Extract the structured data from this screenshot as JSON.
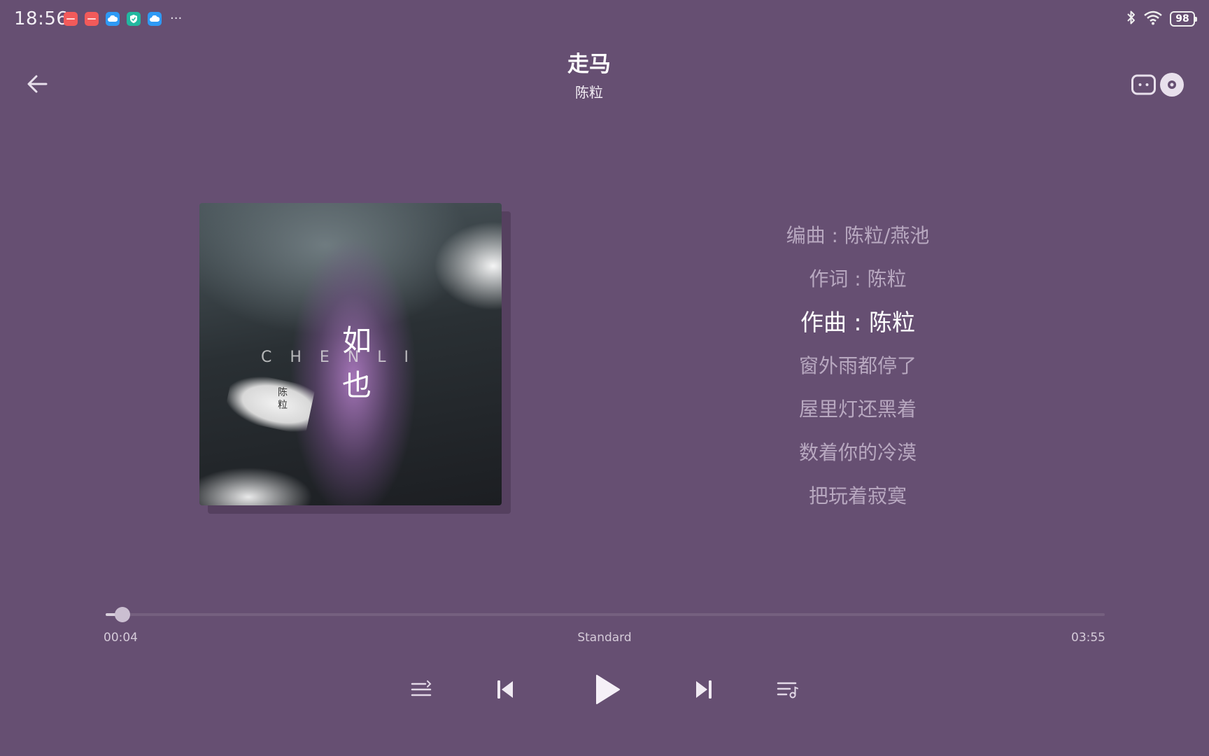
{
  "status_bar": {
    "time": "18:56",
    "notification_icons": [
      "app-notification-icon",
      "app-notification-icon",
      "cloud-icon",
      "shield-icon",
      "cloud-icon"
    ],
    "more": "···",
    "battery": "98"
  },
  "header": {
    "title": "走马",
    "artist": "陈粒"
  },
  "album": {
    "cover_letters": "CHENLI",
    "cover_glyph_top": "如",
    "cover_glyph_bottom": "也",
    "cover_seal": "陈粒"
  },
  "lyrics": [
    {
      "text": "编曲 : 陈粒/燕池",
      "active": false
    },
    {
      "text": "作词 : 陈粒",
      "active": false
    },
    {
      "text": "作曲 : 陈粒",
      "active": true
    },
    {
      "text": "窗外雨都停了",
      "active": false
    },
    {
      "text": "屋里灯还黑着",
      "active": false
    },
    {
      "text": "数着你的冷漠",
      "active": false
    },
    {
      "text": "把玩着寂寞",
      "active": false
    }
  ],
  "progress": {
    "current": "00:04",
    "total": "03:55",
    "quality": "Standard",
    "fraction": 0.017
  },
  "colors": {
    "background": "#664f72",
    "lyric_inactive": "#b8a8c0",
    "lyric_active": "#ffffff"
  }
}
